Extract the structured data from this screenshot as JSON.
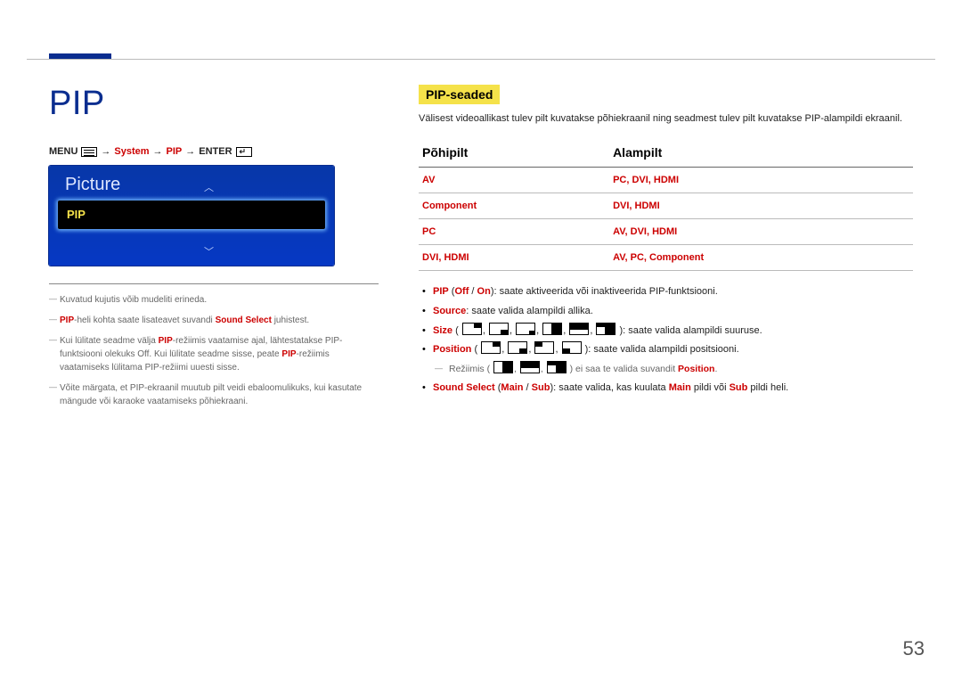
{
  "page_number": "53",
  "left": {
    "title": "PIP",
    "menu_path": {
      "menu": "MENU",
      "item1": "System",
      "item2": "PIP",
      "enter": "ENTER"
    },
    "osd": {
      "title": "Picture",
      "selected": "PIP"
    },
    "notes": [
      {
        "pre": "Kuvatud kujutis võib mudeliti erineda."
      },
      {
        "pre": "",
        "p_red1": "PIP",
        "mid": "-heli kohta saate lisateavet suvandi ",
        "p_red2": "Sound Select",
        "post": " juhistest."
      },
      {
        "pre": "Kui lülitate seadme välja ",
        "p_red1": "PIP",
        "mid": "-režiimis vaatamise ajal, lähtestatakse PIP-funktsiooni olekuks Off. Kui lülitate seadme sisse, peate ",
        "p_red2": "PIP",
        "post": "-režiimis vaatamiseks lülitama PIP-režiimi uuesti sisse."
      },
      {
        "pre": "Võite märgata, et PIP-ekraanil muutub pilt veidi ebaloomulikuks, kui kasutate mängude või karaoke vaatamiseks põhiekraani."
      }
    ]
  },
  "right": {
    "heading": "PIP-seaded",
    "intro": "Välisest videoallikast tulev pilt kuvatakse põhiekraanil ning seadmest tulev pilt kuvatakse PIP-alampildi ekraanil.",
    "table": {
      "h1": "Põhipilt",
      "h2": "Alampilt",
      "rows": [
        {
          "c1": "AV",
          "c2": "PC, DVI, HDMI"
        },
        {
          "c1": "Component",
          "c2": "DVI, HDMI"
        },
        {
          "c1": "PC",
          "c2": "AV, DVI, HDMI"
        },
        {
          "c1": "DVI, HDMI",
          "c2": "AV, PC, Component"
        }
      ]
    },
    "bullets": {
      "b1": {
        "r1": "PIP",
        "t1": " (",
        "r2": "Off",
        "t2": " / ",
        "r3": "On",
        "t3": "): saate aktiveerida või inaktiveerida PIP-funktsiooni."
      },
      "b2": {
        "r1": "Source",
        "t1": ": saate valida alampildi allika."
      },
      "b3": {
        "r1": "Size",
        "t1": " (",
        "t2": "): saate valida alampildi suuruse."
      },
      "b4": {
        "r1": "Position",
        "t1": " (",
        "t2": "): saate valida alampildi positsiooni."
      },
      "d1": {
        "t1": "Režiimis (",
        "t2": ") ei saa te valida suvandit ",
        "r1": "Position",
        "t3": "."
      },
      "b5": {
        "r1": "Sound Select",
        "t1": " (",
        "r2": "Main",
        "t2": " / ",
        "r3": "Sub",
        "t3": "): saate valida, kas kuulata ",
        "r4": "Main",
        "t4": " pildi või ",
        "r5": "Sub",
        "t5": " pildi heli."
      }
    }
  }
}
